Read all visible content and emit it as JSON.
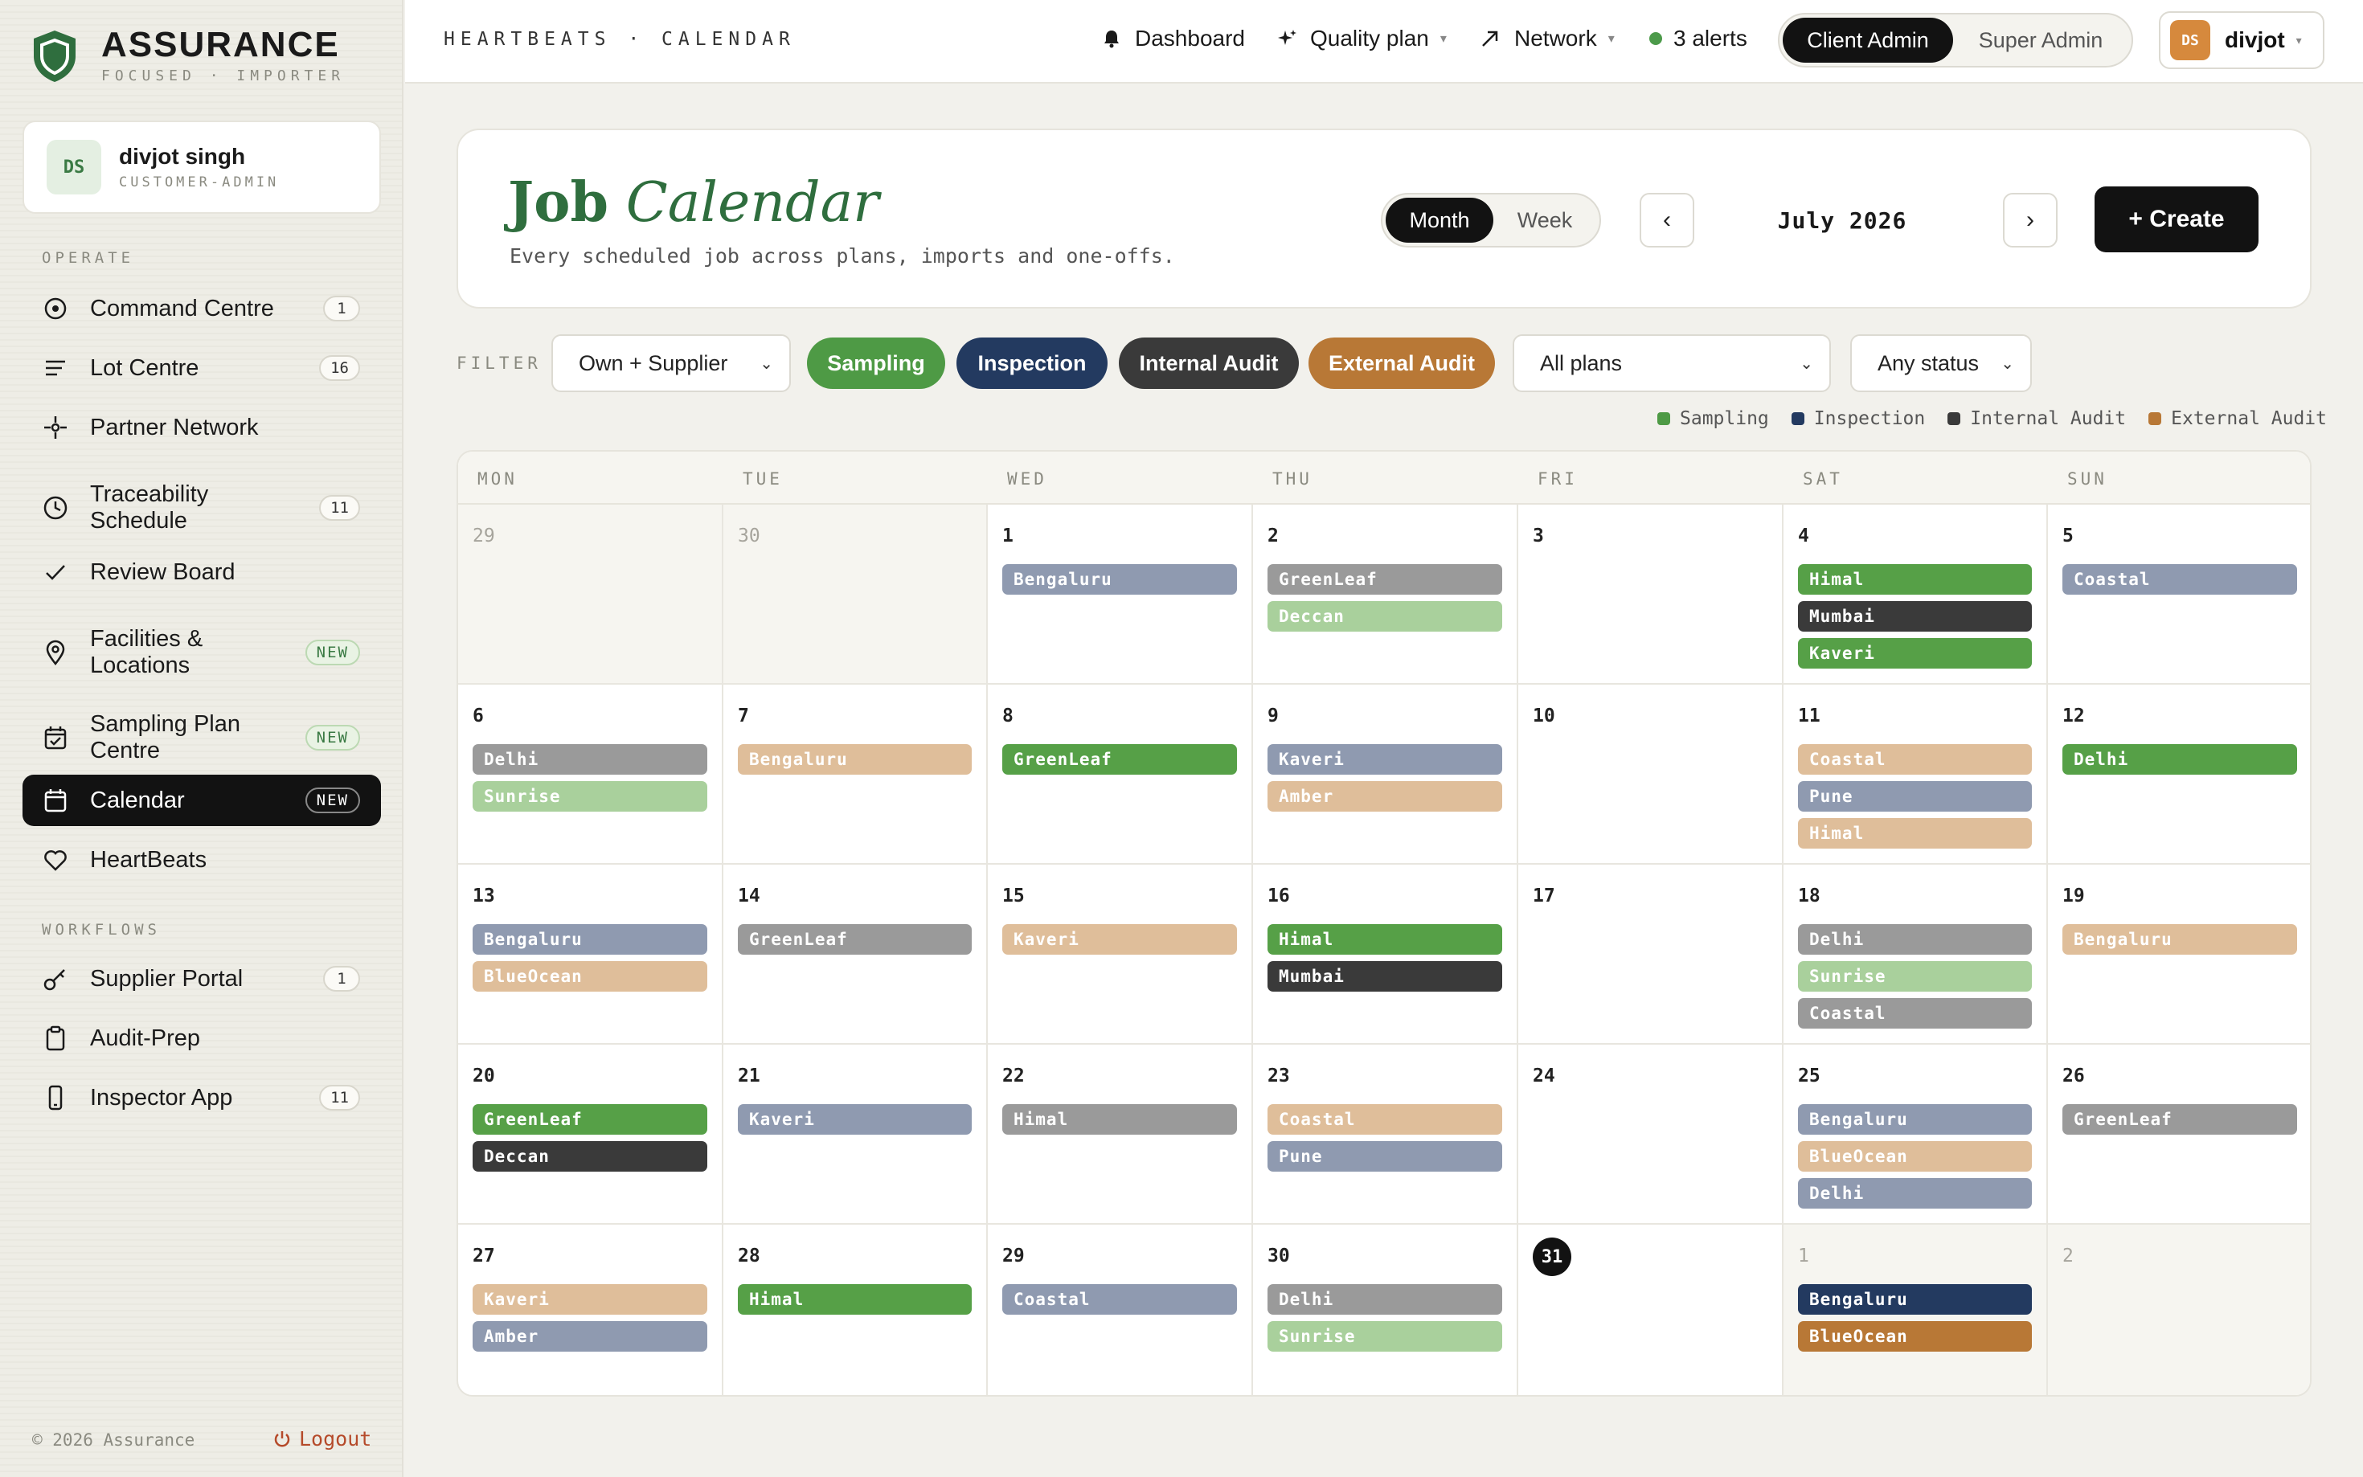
{
  "brand": {
    "name": "ASSURANCE",
    "tagline": "FOCUSED · IMPORTER",
    "accent": "#2f6e3e"
  },
  "user": {
    "initials": "DS",
    "name": "divjot singh",
    "role": "CUSTOMER-ADMIN"
  },
  "sidebar": {
    "operate_label": "OPERATE",
    "workflows_label": "WORKFLOWS",
    "items": [
      {
        "label": "Command Centre",
        "badge": "1",
        "icon": "target-icon"
      },
      {
        "label": "Lot Centre",
        "badge": "16",
        "icon": "lines-icon"
      },
      {
        "label": "Partner Network",
        "badge": "",
        "icon": "crosshair-icon"
      },
      {
        "label": "Traceability\nSchedule",
        "badge": "11",
        "icon": "clock-icon"
      },
      {
        "label": "Review Board",
        "badge": "",
        "icon": "check-icon"
      },
      {
        "label": "Facilities &\nLocations",
        "badge": "NEW",
        "icon": "pin-icon"
      },
      {
        "label": "Sampling Plan\nCentre",
        "badge": "NEW",
        "icon": "calendar-check-icon"
      },
      {
        "label": "Calendar",
        "badge": "NEW",
        "icon": "calendar-icon"
      },
      {
        "label": "HeartBeats",
        "badge": "",
        "icon": "heart-icon"
      },
      {
        "label": "Supplier Portal",
        "badge": "1",
        "icon": "key-icon"
      },
      {
        "label": "Audit-Prep",
        "badge": "",
        "icon": "clipboard-icon"
      },
      {
        "label": "Inspector App",
        "badge": "11",
        "icon": "phone-icon"
      }
    ],
    "footer": "© 2026 Assurance",
    "logout": "Logout"
  },
  "topbar": {
    "breadcrumb": "HEARTBEATS · CALENDAR",
    "dashboard": "Dashboard",
    "quality_plan": "Quality plan",
    "network": "Network",
    "alerts": "3 alerts",
    "role_client": "Client Admin",
    "role_super": "Super Admin",
    "profile_initials": "DS",
    "profile_name": "divjot"
  },
  "header": {
    "title_bold": "Job",
    "title_italic": "Calendar",
    "subtitle": "Every scheduled job across plans, imports and one-offs.",
    "view_month": "Month",
    "view_week": "Week",
    "prev": "‹",
    "next": "›",
    "month": "July 2026",
    "create": "+ Create"
  },
  "filters": {
    "label": "FILTER",
    "scope": "Own + Supplier",
    "plans": "All plans",
    "status": "Any status",
    "chips": [
      {
        "label": "Sampling",
        "color": "#4e9a45"
      },
      {
        "label": "Inspection",
        "color": "#233a60"
      },
      {
        "label": "Internal Audit",
        "color": "#3a3a3a"
      },
      {
        "label": "External Audit",
        "color": "#b87836"
      }
    ]
  },
  "legend": [
    {
      "label": "Sampling",
      "color": "#4e9a45"
    },
    {
      "label": "Inspection",
      "color": "#233a60"
    },
    {
      "label": "Internal Audit",
      "color": "#3a3a3a"
    },
    {
      "label": "External Audit",
      "color": "#b87836"
    }
  ],
  "calendar": {
    "days": [
      "MON",
      "TUE",
      "WED",
      "THU",
      "FRI",
      "SAT",
      "SUN"
    ],
    "today": "31",
    "weeks": [
      [
        {
          "n": "29",
          "out": true,
          "ev": []
        },
        {
          "n": "30",
          "out": true,
          "ev": []
        },
        {
          "n": "1",
          "ev": [
            [
              "Bengaluru",
              "#8f9ab0"
            ]
          ]
        },
        {
          "n": "2",
          "ev": [
            [
              "GreenLeaf",
              "#9a9a9a"
            ],
            [
              "Deccan",
              "#a9d09c"
            ]
          ]
        },
        {
          "n": "3",
          "ev": []
        },
        {
          "n": "4",
          "ev": [
            [
              "Himal",
              "#56a047"
            ],
            [
              "Mumbai",
              "#3a3a3a"
            ],
            [
              "Kaveri",
              "#56a047"
            ]
          ]
        },
        {
          "n": "5",
          "ev": [
            [
              "Coastal",
              "#8f9ab0"
            ]
          ]
        }
      ],
      [
        {
          "n": "6",
          "ev": [
            [
              "Delhi",
              "#9a9a9a"
            ],
            [
              "Sunrise",
              "#a9d09c"
            ]
          ]
        },
        {
          "n": "7",
          "ev": [
            [
              "Bengaluru",
              "#dfbe9a"
            ]
          ]
        },
        {
          "n": "8",
          "ev": [
            [
              "GreenLeaf",
              "#56a047"
            ]
          ]
        },
        {
          "n": "9",
          "ev": [
            [
              "Kaveri",
              "#8f9ab0"
            ],
            [
              "Amber",
              "#dfbe9a"
            ]
          ]
        },
        {
          "n": "10",
          "ev": []
        },
        {
          "n": "11",
          "ev": [
            [
              "Coastal",
              "#dfbe9a"
            ],
            [
              "Pune",
              "#8f9ab0"
            ],
            [
              "Himal",
              "#dfbe9a"
            ]
          ]
        },
        {
          "n": "12",
          "ev": [
            [
              "Delhi",
              "#56a047"
            ]
          ]
        }
      ],
      [
        {
          "n": "13",
          "ev": [
            [
              "Bengaluru",
              "#8f9ab0"
            ],
            [
              "BlueOcean",
              "#dfbe9a"
            ]
          ]
        },
        {
          "n": "14",
          "ev": [
            [
              "GreenLeaf",
              "#9a9a9a"
            ]
          ]
        },
        {
          "n": "15",
          "ev": [
            [
              "Kaveri",
              "#dfbe9a"
            ]
          ]
        },
        {
          "n": "16",
          "ev": [
            [
              "Himal",
              "#56a047"
            ],
            [
              "Mumbai",
              "#3a3a3a"
            ]
          ]
        },
        {
          "n": "17",
          "ev": []
        },
        {
          "n": "18",
          "ev": [
            [
              "Delhi",
              "#9a9a9a"
            ],
            [
              "Sunrise",
              "#a9d09c"
            ],
            [
              "Coastal",
              "#9a9a9a"
            ]
          ]
        },
        {
          "n": "19",
          "ev": [
            [
              "Bengaluru",
              "#dfbe9a"
            ]
          ]
        }
      ],
      [
        {
          "n": "20",
          "ev": [
            [
              "GreenLeaf",
              "#56a047"
            ],
            [
              "Deccan",
              "#3a3a3a"
            ]
          ]
        },
        {
          "n": "21",
          "ev": [
            [
              "Kaveri",
              "#8f9ab0"
            ]
          ]
        },
        {
          "n": "22",
          "ev": [
            [
              "Himal",
              "#9a9a9a"
            ]
          ]
        },
        {
          "n": "23",
          "ev": [
            [
              "Coastal",
              "#dfbe9a"
            ],
            [
              "Pune",
              "#8f9ab0"
            ]
          ]
        },
        {
          "n": "24",
          "ev": []
        },
        {
          "n": "25",
          "ev": [
            [
              "Bengaluru",
              "#8f9ab0"
            ],
            [
              "BlueOcean",
              "#dfbe9a"
            ],
            [
              "Delhi",
              "#8f9ab0"
            ]
          ]
        },
        {
          "n": "26",
          "ev": [
            [
              "GreenLeaf",
              "#9a9a9a"
            ]
          ]
        }
      ],
      [
        {
          "n": "27",
          "ev": [
            [
              "Kaveri",
              "#dfbe9a"
            ],
            [
              "Amber",
              "#8f9ab0"
            ]
          ]
        },
        {
          "n": "28",
          "ev": [
            [
              "Himal",
              "#56a047"
            ]
          ]
        },
        {
          "n": "29",
          "ev": [
            [
              "Coastal",
              "#8f9ab0"
            ]
          ]
        },
        {
          "n": "30",
          "ev": [
            [
              "Delhi",
              "#9a9a9a"
            ],
            [
              "Sunrise",
              "#a9d09c"
            ]
          ]
        },
        {
          "n": "31",
          "ev": []
        },
        {
          "n": "1",
          "out": true,
          "ev": [
            [
              "Bengaluru",
              "#233a60"
            ],
            [
              "BlueOcean",
              "#b87836"
            ]
          ]
        },
        {
          "n": "2",
          "out": true,
          "ev": []
        }
      ]
    ]
  }
}
